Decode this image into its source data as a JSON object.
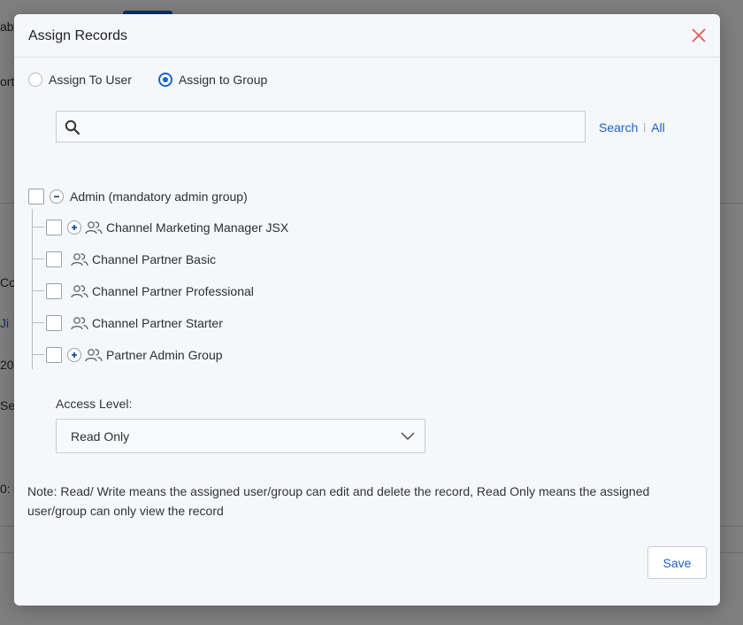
{
  "background": {
    "fragments": [
      "ab",
      "ortu",
      "Co",
      "Ji",
      "20",
      "Se",
      "0:"
    ]
  },
  "modal": {
    "title": "Assign Records",
    "close_icon": "close-icon",
    "radios": [
      {
        "label": "Assign To User",
        "checked": false
      },
      {
        "label": "Assign to Group",
        "checked": true
      }
    ],
    "search": {
      "placeholder": "",
      "value": "",
      "search_link": "Search",
      "all_link": "All"
    },
    "tree": {
      "root": {
        "label": "Admin (mandatory admin group)",
        "expanded": true
      },
      "children": [
        {
          "label": "Channel Marketing Manager JSX",
          "expandable": true
        },
        {
          "label": "Channel Partner Basic",
          "expandable": false
        },
        {
          "label": "Channel Partner Professional",
          "expandable": false
        },
        {
          "label": "Channel Partner Starter",
          "expandable": false
        },
        {
          "label": "Partner Admin Group",
          "expandable": true
        }
      ]
    },
    "access_level": {
      "label": "Access Level:",
      "value": "Read Only"
    },
    "note": "Note: Read/ Write means the assigned user/group can edit and delete the record, Read Only means the assigned user/group can only view the record",
    "save_label": "Save"
  },
  "colors": {
    "accent": "#1a63c9",
    "close": "#e0554f",
    "modal_bg": "#f5f7fa"
  }
}
